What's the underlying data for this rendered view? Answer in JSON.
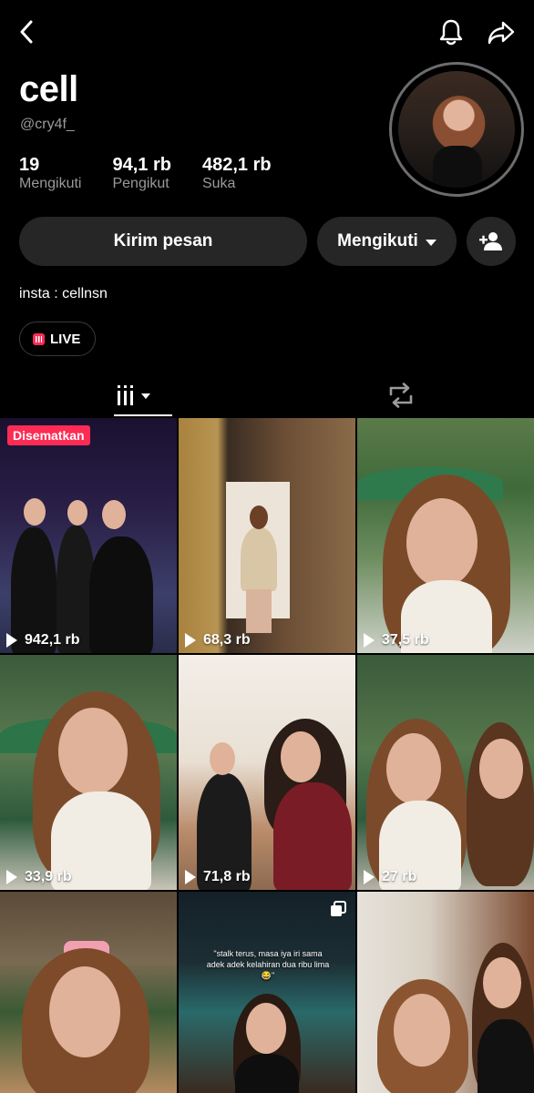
{
  "header": {
    "back_icon": "chevron-left-icon",
    "notification_icon": "bell-icon",
    "share_icon": "share-arrow-icon"
  },
  "profile": {
    "display_name": "cell",
    "username": "@cry4f_",
    "stats": [
      {
        "value": "19",
        "label": "Mengikuti"
      },
      {
        "value": "94,1 rb",
        "label": "Pengikut"
      },
      {
        "value": "482,1 rb",
        "label": "Suka"
      }
    ],
    "bio": "insta : cellnsn",
    "live_label": "LIVE"
  },
  "actions": {
    "message_label": "Kirim pesan",
    "following_label": "Mengikuti",
    "add_friend_icon": "add-user-icon"
  },
  "tabs": [
    {
      "name": "videos",
      "icon": "grid-icon"
    },
    {
      "name": "reposts",
      "icon": "repost-icon"
    }
  ],
  "videos": [
    {
      "views": "942,1 rb",
      "pinned_label": "Disematkan"
    },
    {
      "views": "68,3 rb"
    },
    {
      "views": "37,5 rb"
    },
    {
      "views": "33,9 rb"
    },
    {
      "views": "71,8 rb"
    },
    {
      "views": "27 rb"
    },
    {
      "views": ""
    },
    {
      "views": "",
      "caption": "\"stalk terus, masa iya iri sama adek adek kelahiran dua ribu lima😂\""
    },
    {
      "views": ""
    }
  ],
  "colors": {
    "background": "#000000",
    "button": "#262626",
    "accent": "#fe2c55",
    "secondary_text": "#9a9a9a"
  }
}
